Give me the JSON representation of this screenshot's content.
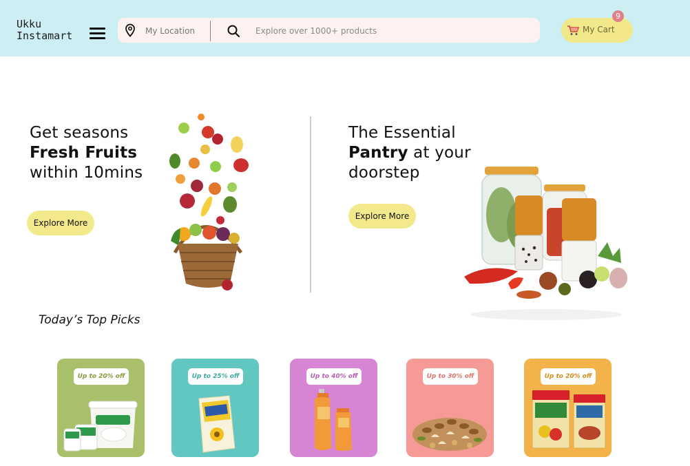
{
  "header": {
    "logo_line1": "Ukku",
    "logo_line2": "Instamart",
    "location_placeholder": "My Location",
    "search_placeholder": "Explore over 1000+ products",
    "cart_label": "My Cart",
    "cart_count": "9"
  },
  "hero": {
    "fruits": {
      "line1": "Get seasons",
      "bold": "Fresh Fruits",
      "line3": "within 10mins",
      "button": "Explore More"
    },
    "pantry": {
      "line1": "The Essential",
      "bold": "Pantry",
      "rest": " at your",
      "line3": "doorstep",
      "button": "Explore More"
    }
  },
  "top_picks": {
    "title": "Today’s Top Picks",
    "cards": [
      {
        "deal": "Up to 20% off",
        "bg": "#a9c06a",
        "tag_color": "#8a9a3f"
      },
      {
        "deal": "Up to 25% off",
        "bg": "#62c6c1",
        "tag_color": "#3aa8a2"
      },
      {
        "deal": "Up to 40% off",
        "bg": "#d884d4",
        "tag_color": "#b55fb1"
      },
      {
        "deal": "Up to 30% off",
        "bg": "#f59a94",
        "tag_color": "#d9776f"
      },
      {
        "deal": "Up to 20% off",
        "bg": "#f4b24a",
        "tag_color": "#d08d20"
      }
    ]
  },
  "colors": {
    "header_bg": "#cdeff4",
    "button_yellow": "#f2e98c",
    "search_bg": "#fdf1f1"
  }
}
